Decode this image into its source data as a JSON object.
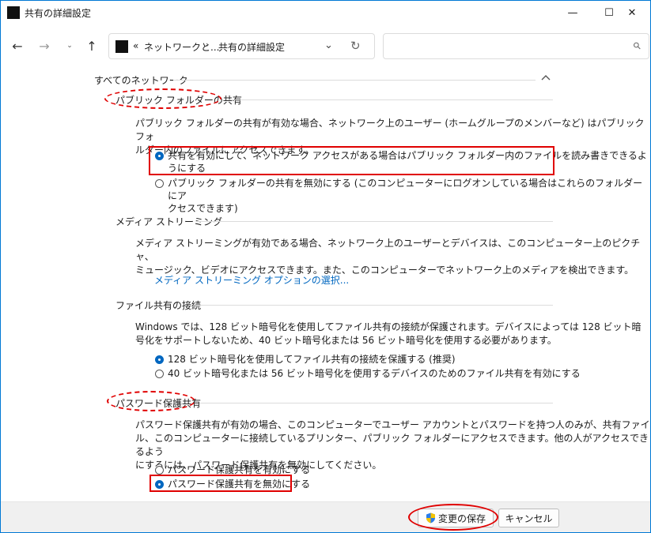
{
  "window": {
    "title": "共有の詳細設定",
    "controls": {
      "minimize": "—",
      "maximize": "☐",
      "close": "✕"
    }
  },
  "nav": {
    "back": "←",
    "forward": "→",
    "recent": "⌄",
    "up": "↑",
    "breadcrumb": {
      "overflow": "«",
      "part1": "ネットワークと...",
      "sep": "›",
      "part2": "共有の詳細設定"
    },
    "dropdown": "⌄",
    "refresh": "↻",
    "search_placeholder": "",
    "search_icon": "⚲"
  },
  "content": {
    "header": "すべてのネットワーク",
    "public_folder": {
      "title": "パブリック フォルダーの共有",
      "desc_line1": "パブリック フォルダーの共有が有効な場合、ネットワーク上のユーザー (ホームグループのメンバーなど) はパブリック フォ",
      "desc_line2": "ルダー内のファイルにアクセスできます。",
      "option1_line1": "共有を有効にして、ネットワーク アクセスがある場合はパブリック フォルダー内のファイルを読み書きできるよ",
      "option1_line2": "うにする",
      "option2_line1": "パブリック フォルダーの共有を無効にする (このコンピューターにログオンしている場合はこれらのフォルダーにア",
      "option2_line2": "クセスできます)"
    },
    "media": {
      "title": "メディア ストリーミング",
      "desc_line1": "メディア ストリーミングが有効である場合、ネットワーク上のユーザーとデバイスは、このコンピューター上のピクチャ、",
      "desc_line2": "ミュージック、ビデオにアクセスできます。また、このコンピューターでネットワーク上のメディアを検出できます。",
      "link": "メディア ストリーミング オプションの選択..."
    },
    "file_sharing": {
      "title": "ファイル共有の接続",
      "desc_line1": "Windows では、128 ビット暗号化を使用してファイル共有の接続が保護されます。デバイスによっては 128 ビット暗",
      "desc_line2": "号化をサポートしないため、40 ビット暗号化または 56 ビット暗号化を使用する必要があります。",
      "option1": "128 ビット暗号化を使用してファイル共有の接続を保護する (推奨)",
      "option2": "40 ビット暗号化または 56 ビット暗号化を使用するデバイスのためのファイル共有を有効にする"
    },
    "password": {
      "title": "パスワード保護共有",
      "desc_line1": "パスワード保護共有が有効の場合、このコンピューターでユーザー アカウントとパスワードを持つ人のみが、共有ファイ",
      "desc_line2": "ル、このコンピューターに接続しているプリンター、パブリック フォルダーにアクセスできます。他の人がアクセスできるよう",
      "desc_line3": "にするには、パスワード保護共有を無効にしてください。",
      "option1": "パスワード保護共有を有効にする",
      "option2": "パスワード保護共有を無効にする"
    }
  },
  "footer": {
    "save": "変更の保存",
    "cancel": "キャンセル"
  },
  "colors": {
    "accent": "#0067c0",
    "highlight": "#e00000"
  }
}
